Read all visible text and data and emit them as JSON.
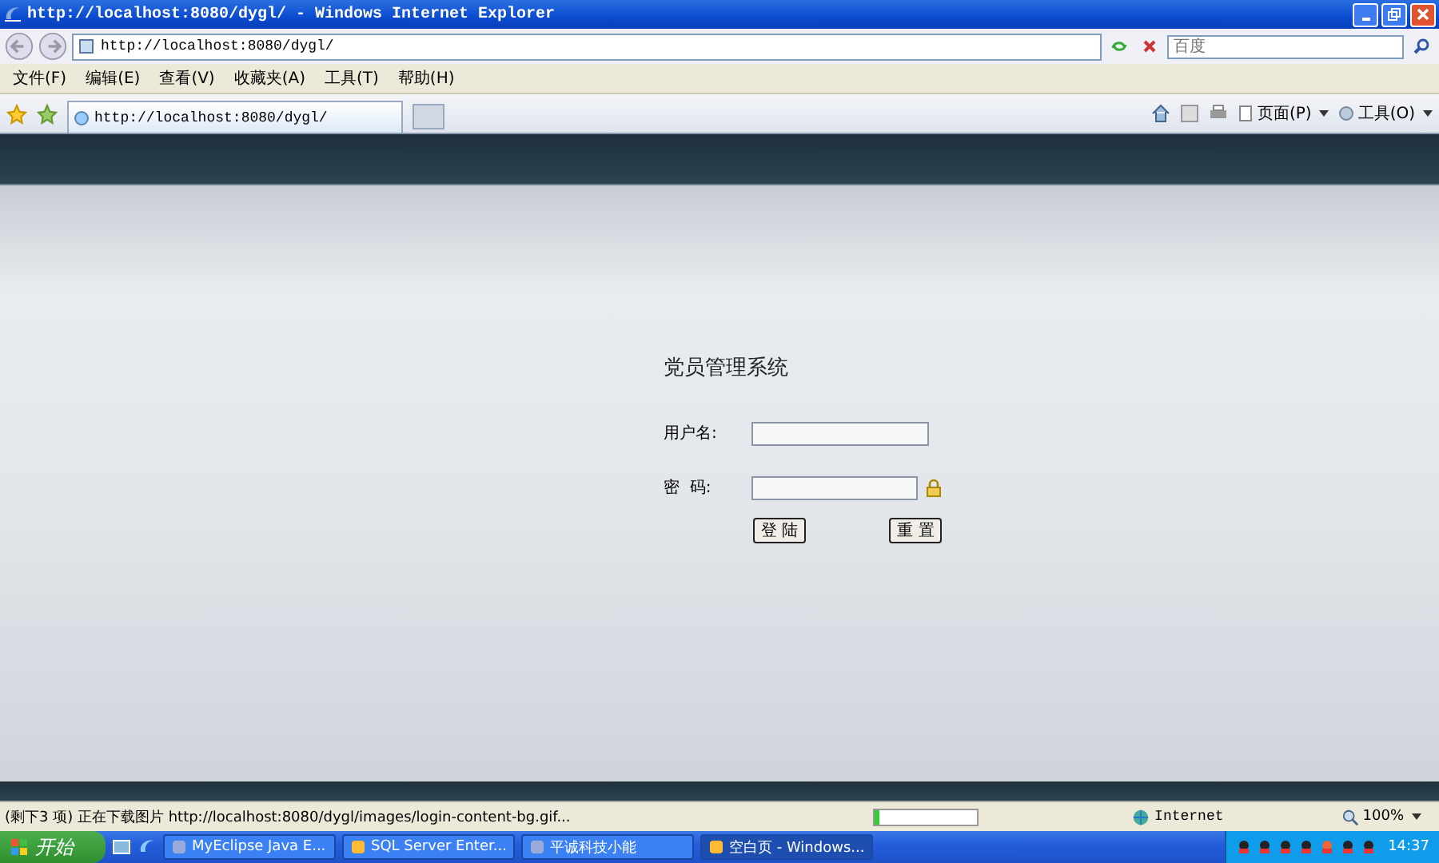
{
  "window": {
    "title": "http://localhost:8080/dygl/ - Windows Internet Explorer"
  },
  "address_bar": {
    "value": "http://localhost:8080/dygl/"
  },
  "search": {
    "placeholder": "百度"
  },
  "menu": [
    "文件(F)",
    "编辑(E)",
    "查看(V)",
    "收藏夹(A)",
    "工具(T)",
    "帮助(H)"
  ],
  "tabs": [
    {
      "label": "http://localhost:8080/dygl/",
      "selected": true
    }
  ],
  "command_bar": [
    "页面(P)",
    "工具(O)"
  ],
  "login": {
    "title": "党员管理系统",
    "fields": [
      {
        "label": "用户名:",
        "kind": "text"
      },
      {
        "label": "密  码:",
        "kind": "password"
      }
    ],
    "buttons": [
      "登 陆",
      "重 置"
    ]
  },
  "status_bar": {
    "text": "(剩下3 项) 正在下载图片 http://localhost:8080/dygl/images/login-content-bg.gif...",
    "progress": {
      "level": 0.05
    },
    "zone": "Internet",
    "zoom": "100%"
  },
  "taskbar": {
    "start": "开始",
    "items": [
      {
        "label": "MyEclipse Java E...",
        "selected": false
      },
      {
        "label": "SQL Server Enter...",
        "selected": false
      },
      {
        "label": "平诚科技小能",
        "selected": false
      },
      {
        "label": "空白页 - Windows...",
        "selected": true
      }
    ],
    "clock": "14:37"
  }
}
